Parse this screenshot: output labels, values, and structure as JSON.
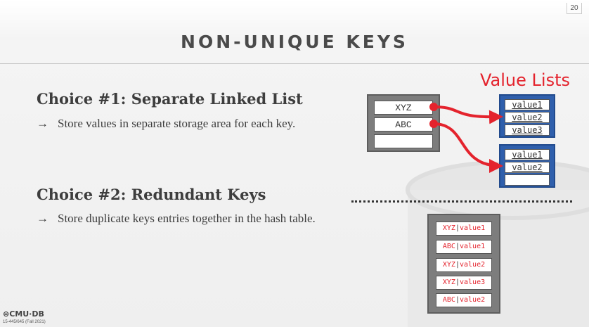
{
  "page_number": "20",
  "title": "NON-UNIQUE KEYS",
  "choices": [
    {
      "heading": "Choice #1: Separate Linked List",
      "bullet_arrow": "→",
      "bullet": "Store values in separate storage area for each key."
    },
    {
      "heading": "Choice #2: Redundant Keys",
      "bullet_arrow": "→",
      "bullet": "Store duplicate keys entries together in the hash table."
    }
  ],
  "diagram": {
    "value_lists_label": "Value Lists",
    "hash_table_slots": [
      "XYZ",
      "ABC",
      ""
    ],
    "value_list_1": [
      "value1",
      "value2",
      "value3"
    ],
    "value_list_2": [
      "value1",
      "value2",
      ""
    ],
    "redundant_slots": [
      {
        "key": "XYZ",
        "sep": "|",
        "value": "value1"
      },
      {
        "key": "ABC",
        "sep": "|",
        "value": "value1"
      },
      {
        "key": "XYZ",
        "sep": "|",
        "value": "value2"
      },
      {
        "key": "XYZ",
        "sep": "|",
        "value": "value3"
      },
      {
        "key": "ABC",
        "sep": "|",
        "value": "value2"
      }
    ],
    "colors": {
      "accent_red": "#e4232d",
      "list_blue": "#2f5fac",
      "table_gray": "#7d7d7d"
    }
  },
  "footer": {
    "logo": "⊜CMU·DB",
    "course": "15-445/645 (Fall 2021)"
  }
}
